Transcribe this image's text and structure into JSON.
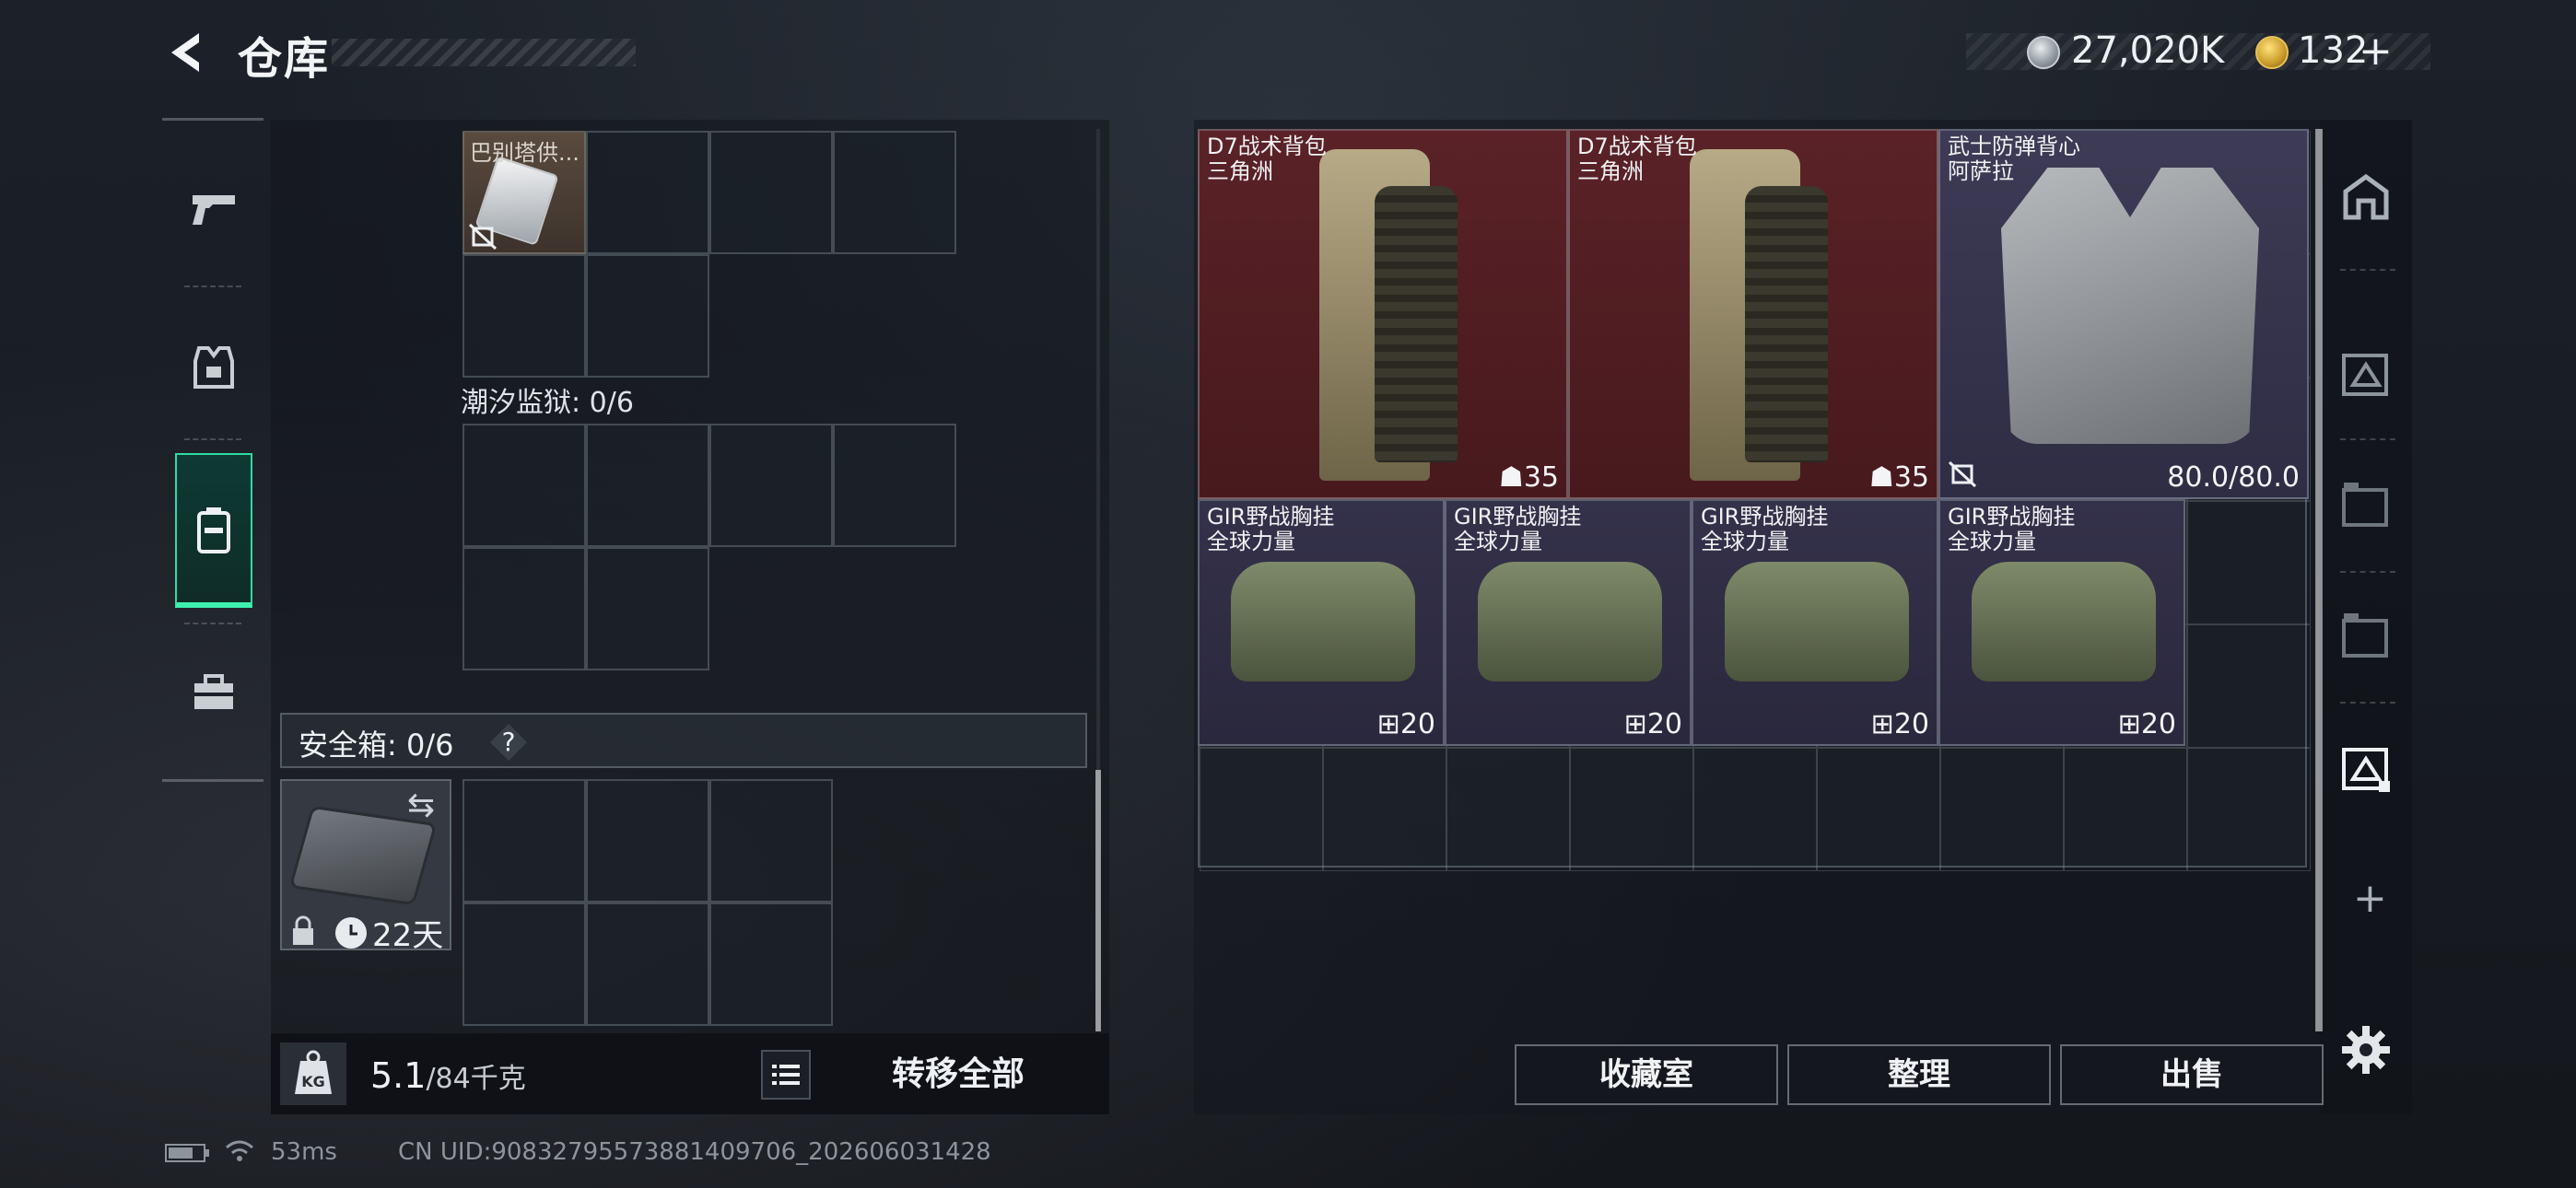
{
  "header": {
    "title": "仓库",
    "currency_silver": "27,020K",
    "currency_gold": "132",
    "plus_label": "+"
  },
  "left_panel": {
    "intel_item_name": "巴别塔供...",
    "prison_label": "潮汐监狱: 0/6",
    "safe_box_label": "安全箱: 0/6",
    "help_label": "?",
    "safe_case_days": "22天",
    "weight_current": "5.1",
    "weight_capacity": "/84千克",
    "transfer_all": "转移全部"
  },
  "stash": {
    "items": [
      {
        "name": "D7战术背包",
        "sub": "三角洲",
        "value": "35"
      },
      {
        "name": "D7战术背包",
        "sub": "三角洲",
        "value": "35"
      },
      {
        "name": "武士防弹背心",
        "sub": "阿萨拉",
        "value": "80.0/80.0"
      },
      {
        "name": "GIR野战胸挂",
        "sub": "全球力量",
        "value": "20"
      },
      {
        "name": "GIR野战胸挂",
        "sub": "全球力量",
        "value": "20"
      },
      {
        "name": "GIR野战胸挂",
        "sub": "全球力量",
        "value": "20"
      },
      {
        "name": "GIR野战胸挂",
        "sub": "全球力量",
        "value": "20"
      }
    ]
  },
  "actions": {
    "collection": "收藏室",
    "organize": "整理",
    "sell": "出售"
  },
  "status_bar": {
    "ping": "53ms",
    "uid": "CN UID:908327955738814097​06_202606031428"
  },
  "colors": {
    "accent_green": "#3ef0b0",
    "rarity_red": "#5a2227",
    "rarity_purple": "#34314a"
  }
}
